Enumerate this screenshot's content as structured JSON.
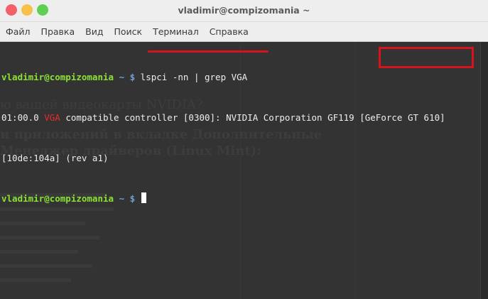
{
  "window": {
    "title": "vladimir@compizomania ~"
  },
  "menubar": {
    "items": [
      "Файл",
      "Правка",
      "Вид",
      "Поиск",
      "Терминал",
      "Справка"
    ]
  },
  "terminal": {
    "line1": {
      "user_host": "vladimir@compizomania",
      "path": " ~ $",
      "command": " lspci -nn | grep VGA"
    },
    "line2": {
      "prefix": "01:00.0 ",
      "match": "VGA",
      "rest": " compatible controller [0300]: NVIDIA Corporation GF119 [GeForce GT 610]"
    },
    "line3": {
      "text": "[10de:104a] (rev a1)"
    },
    "line4": {
      "user_host": "vladimir@compizomania",
      "path": " ~ $",
      "command": " "
    }
  },
  "background_page": {
    "heading_fragment": "ю вашей видеокарты NVIDIA?",
    "bold_fragment_1": "и приложений в вкладке Дополнительные",
    "bold_fragment_2": "Менеджер драйверов (Linux Mint):"
  },
  "colors": {
    "terminal_bg": "#333333",
    "prompt_user": "#8ae234",
    "prompt_path": "#729fcf",
    "grep_match": "#ef2929",
    "annotation_red": "#d7141c"
  }
}
